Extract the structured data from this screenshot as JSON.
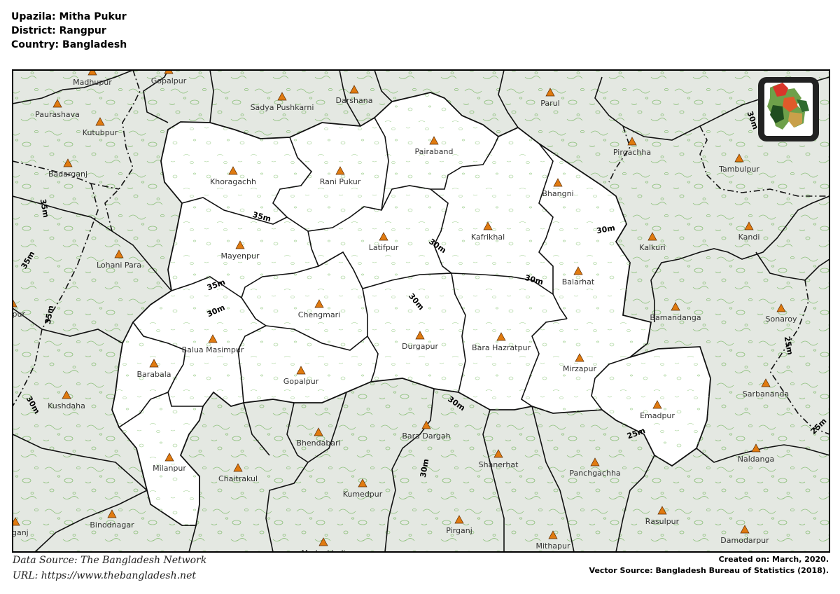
{
  "header": {
    "upazila": "Upazila: Mitha Pukur",
    "district": "District: Rangpur",
    "country": "Country: Bangladesh"
  },
  "footer": {
    "data_source": "Data Source: The Bangladesh Network",
    "url": "URL: https://www.thebangladesh.net",
    "created": "Created on: March, 2020.",
    "vector_source": "Vector Source: Bangladesh Bureau of Statistics (2018)."
  },
  "colors": {
    "outside_fill": "#e4e8e2",
    "inside_fill": "#ffffff",
    "contour": "#8cbf7a",
    "marker_fill": "#e07a10",
    "boundary": "#111111"
  },
  "places_inside": [
    "Khoragachh",
    "Rani Pukur",
    "Pairaband",
    "Bhangni",
    "Mayenpur",
    "Latifpur",
    "Kafrikhal",
    "Balarhat",
    "Chengmari",
    "Durgapur",
    "Bara Hazratpur",
    "Balua Masimpur",
    "Gopalpur",
    "Mirzapur",
    "Emadpur",
    "Barabala",
    "Milanpur"
  ],
  "places_outside": [
    "Madhupur",
    "Gopalpur",
    "Darshana",
    "Sadya Pushkarni",
    "Parul",
    "Paurashava",
    "Kutubpur",
    "Pirgachha",
    "Tambulpur",
    "Badarganj",
    "Kandi",
    "Lohani Para",
    "Kalkuri",
    "Bamandanga",
    "Sonaroy",
    "ampur",
    "Kushdaha",
    "Sarbananda",
    "Bhendabari",
    "Bara Dargah",
    "Shanerhat",
    "Panchgachha",
    "Naldanga",
    "Chaitrakul",
    "Kumedpur",
    "Binodnagar",
    "Rasulpur",
    "apganj",
    "Pirganj",
    "Mithapur",
    "Damodarpur",
    "Madankhali"
  ],
  "contour_labels": [
    "35m",
    "30m",
    "30m",
    "35m",
    "30m",
    "30m",
    "30m",
    "35m",
    "35m",
    "35m",
    "30m",
    "25m",
    "25m",
    "25m",
    "30m",
    "30m",
    "30m"
  ],
  "inset": {
    "name": "bangladesh-locator-map"
  }
}
